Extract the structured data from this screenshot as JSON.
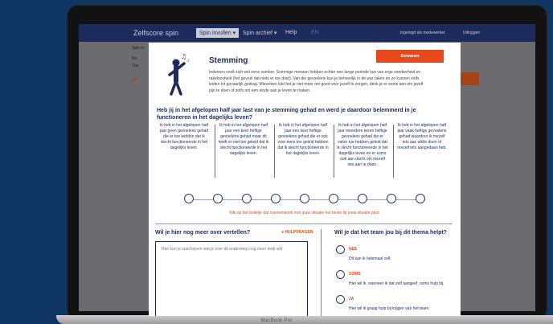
{
  "app": {
    "brand": "Zelfscore spin",
    "nav": [
      "Spin invullen ▾",
      "Spin archief ▾",
      "Help",
      "EN"
    ],
    "right_links": [
      "Ingelogd als medewerker",
      "Uitloggen"
    ],
    "side_label": "Spin in",
    "side_items": [
      "Nu",
      "Tus"
    ],
    "side_warning": "uit"
  },
  "laptop": {
    "brand": "MacBook Pro"
  },
  "modal": {
    "title": "Stemming",
    "intro": "Iedereen voelt zich wel eens somber. Sommige mensen hebben echter een lange periode last van erge somberheid en rakeloosheid (het gevoel dat niets er toe doet). Van die gevoelens kun je behoorlijk in de war raken en ze kunnen zelfs leiden tot gevaarlijk gedrag. Misschien lukt het je niet meer om goed voor jezelf te zorgen, denk je er soms aan om jezelf pijn te doen of zelfs om een einde aan je leven te maken.",
    "save_label": "Bewaren",
    "question": "Heb jij in het afgelopen half jaar last van je stemming gehad en werd je daardoor belemmerd in je functioneren in het dagelijks leven?",
    "options": [
      "Ik heb in het afgelopen half jaar geen gevoelens gehad die er toe leidden dat ik slecht functioneerde in het dagelijks leven.",
      "Ik heb in het afgelopen half jaar een keer heftige gevoelens gehad maar dit heeft er niet toe geleid dat ik slecht functioneerde in het dagelijks leven.",
      "Ik heb in het afgelopen half jaar een keer heftige gevoelens gehad die er ook voor eens toe geleid hebben dat ik slecht functioneerde in het dagelijks leven.",
      "Ik heb in het afgelopen half jaar meerdere keren heftige gevoelens gehad die er vaker toe hebben geleid dat ik slecht functioneerde in het dagelijks leven en er soms ook aan dacht om mezelf iets aan te doen.",
      "Ik heb in het afgelopen half jaar vaak heftige gevoelens gehad waardoor ik mezelf iets aan wilde doen of mezelf iets aangedaan heb."
    ],
    "scale_hint": "Klik op het bolletje dat overeenkomt met jouw situatie het beste bij jouw situatie past.",
    "more_title": "Wil je hier nog meer over vertellen?",
    "help_label": "HULPVRAGEN",
    "more_placeholder": "Hier kun je opschrijven wat je over dit onderwerp nog meer kwijt wilt",
    "team_title": "Wil je dat het team jou bij dit thema helpt?",
    "team_options": [
      {
        "label": "NEE",
        "sub": "Dit kan ik helemaal zelf."
      },
      {
        "label": "SOMS",
        "sub": "Hier wil ik, wanneer ik dat zelf aangeef, soms hulp bij."
      },
      {
        "label": "JA",
        "sub": "Hier wil ik graag hulp bij krijgen van het team."
      }
    ]
  },
  "colors": {
    "navy": "#1d2b5c",
    "accent": "#e8481c"
  },
  "icons": [
    "person-with-music-note-icon",
    "lightbulb-icon"
  ]
}
